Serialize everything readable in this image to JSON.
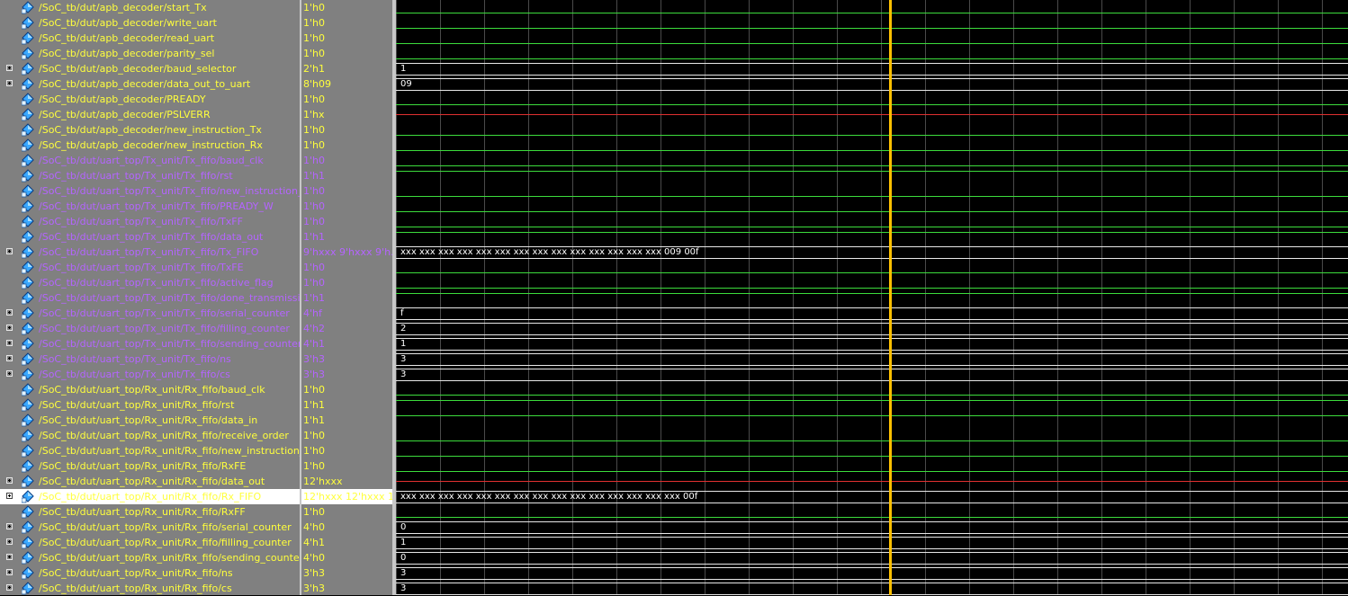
{
  "colors": {
    "tx_text": "#b464ff",
    "rx_text": "#ffff3c",
    "wave_zero": "#3cdc3c",
    "wave_x": "#e03030",
    "wave_bus": "#e8e8e8",
    "cursor": "#ffc000"
  },
  "icons": {
    "expand": "plus-box-icon",
    "signal": "diamond-signal-icon"
  },
  "signals": [
    {
      "name": "/SoC_tb/dut/apb_decoder/start_Tx",
      "value": "1'h0",
      "group": "apb",
      "bus": false,
      "wave": "0"
    },
    {
      "name": "/SoC_tb/dut/apb_decoder/write_uart",
      "value": "1'h0",
      "group": "apb",
      "bus": false,
      "wave": "0"
    },
    {
      "name": "/SoC_tb/dut/apb_decoder/read_uart",
      "value": "1'h0",
      "group": "apb",
      "bus": false,
      "wave": "0"
    },
    {
      "name": "/SoC_tb/dut/apb_decoder/parity_sel",
      "value": "1'h0",
      "group": "apb",
      "bus": false,
      "wave": "0"
    },
    {
      "name": "/SoC_tb/dut/apb_decoder/baud_selector",
      "value": "2'h1",
      "group": "apb",
      "bus": true,
      "wave": "bus",
      "label": "1"
    },
    {
      "name": "/SoC_tb/dut/apb_decoder/data_out_to_uart",
      "value": "8'h09",
      "group": "apb",
      "bus": true,
      "wave": "bus",
      "label": "09"
    },
    {
      "name": "/SoC_tb/dut/apb_decoder/PREADY",
      "value": "1'h0",
      "group": "apb",
      "bus": false,
      "wave": "0"
    },
    {
      "name": "/SoC_tb/dut/apb_decoder/PSLVERR",
      "value": "1'hx",
      "group": "apb",
      "bus": false,
      "wave": "x"
    },
    {
      "name": "/SoC_tb/dut/apb_decoder/new_instruction_Tx",
      "value": "1'h0",
      "group": "apb",
      "bus": false,
      "wave": "0"
    },
    {
      "name": "/SoC_tb/dut/apb_decoder/new_instruction_Rx",
      "value": "1'h0",
      "group": "apb",
      "bus": false,
      "wave": "0"
    },
    {
      "name": "/SoC_tb/dut/uart_top/Tx_unit/Tx_fifo/baud_clk",
      "value": "1'h0",
      "group": "tx",
      "bus": false,
      "wave": "0"
    },
    {
      "name": "/SoC_tb/dut/uart_top/Tx_unit/Tx_fifo/rst",
      "value": "1'h1",
      "group": "tx",
      "bus": false,
      "wave": "1"
    },
    {
      "name": "/SoC_tb/dut/uart_top/Tx_unit/Tx_fifo/new_instruction_Tx",
      "value": "1'h0",
      "group": "tx",
      "bus": false,
      "wave": "0"
    },
    {
      "name": "/SoC_tb/dut/uart_top/Tx_unit/Tx_fifo/PREADY_W",
      "value": "1'h0",
      "group": "tx",
      "bus": false,
      "wave": "0"
    },
    {
      "name": "/SoC_tb/dut/uart_top/Tx_unit/Tx_fifo/TxFF",
      "value": "1'h0",
      "group": "tx",
      "bus": false,
      "wave": "0"
    },
    {
      "name": "/SoC_tb/dut/uart_top/Tx_unit/Tx_fifo/data_out",
      "value": "1'h1",
      "group": "tx",
      "bus": false,
      "wave": "1"
    },
    {
      "name": "/SoC_tb/dut/uart_top/Tx_unit/Tx_fifo/Tx_FIFO",
      "value": "9'hxxx 9'hxxx 9'h...",
      "group": "tx",
      "bus": true,
      "wave": "bus",
      "label": "xxx xxx xxx xxx xxx xxx xxx xxx xxx xxx xxx xxx xxx xxx 009 00f"
    },
    {
      "name": "/SoC_tb/dut/uart_top/Tx_unit/Tx_fifo/TxFE",
      "value": "1'h0",
      "group": "tx",
      "bus": false,
      "wave": "0"
    },
    {
      "name": "/SoC_tb/dut/uart_top/Tx_unit/Tx_fifo/active_flag",
      "value": "1'h0",
      "group": "tx",
      "bus": false,
      "wave": "0"
    },
    {
      "name": "/SoC_tb/dut/uart_top/Tx_unit/Tx_fifo/done_transmission",
      "value": "1'h1",
      "group": "tx",
      "bus": false,
      "wave": "1"
    },
    {
      "name": "/SoC_tb/dut/uart_top/Tx_unit/Tx_fifo/serial_counter",
      "value": "4'hf",
      "group": "tx",
      "bus": true,
      "wave": "bus",
      "label": "f"
    },
    {
      "name": "/SoC_tb/dut/uart_top/Tx_unit/Tx_fifo/filling_counter",
      "value": "4'h2",
      "group": "tx",
      "bus": true,
      "wave": "bus",
      "label": "2"
    },
    {
      "name": "/SoC_tb/dut/uart_top/Tx_unit/Tx_fifo/sending_counter",
      "value": "4'h1",
      "group": "tx",
      "bus": true,
      "wave": "bus",
      "label": "1"
    },
    {
      "name": "/SoC_tb/dut/uart_top/Tx_unit/Tx_fifo/ns",
      "value": "3'h3",
      "group": "tx",
      "bus": true,
      "wave": "bus",
      "label": "3"
    },
    {
      "name": "/SoC_tb/dut/uart_top/Tx_unit/Tx_fifo/cs",
      "value": "3'h3",
      "group": "tx",
      "bus": true,
      "wave": "bus",
      "label": "3"
    },
    {
      "name": "/SoC_tb/dut/uart_top/Rx_unit/Rx_fifo/baud_clk",
      "value": "1'h0",
      "group": "rx",
      "bus": false,
      "wave": "0"
    },
    {
      "name": "/SoC_tb/dut/uart_top/Rx_unit/Rx_fifo/rst",
      "value": "1'h1",
      "group": "rx",
      "bus": false,
      "wave": "1"
    },
    {
      "name": "/SoC_tb/dut/uart_top/Rx_unit/Rx_fifo/data_in",
      "value": "1'h1",
      "group": "rx",
      "bus": false,
      "wave": "1"
    },
    {
      "name": "/SoC_tb/dut/uart_top/Rx_unit/Rx_fifo/receive_order",
      "value": "1'h0",
      "group": "rx",
      "bus": false,
      "wave": "0"
    },
    {
      "name": "/SoC_tb/dut/uart_top/Rx_unit/Rx_fifo/new_instruction_Rx",
      "value": "1'h0",
      "group": "rx",
      "bus": false,
      "wave": "0"
    },
    {
      "name": "/SoC_tb/dut/uart_top/Rx_unit/Rx_fifo/RxFE",
      "value": "1'h0",
      "group": "rx",
      "bus": false,
      "wave": "0"
    },
    {
      "name": "/SoC_tb/dut/uart_top/Rx_unit/Rx_fifo/data_out",
      "value": "12'hxxx",
      "group": "rx",
      "bus": true,
      "wave": "x"
    },
    {
      "name": "/SoC_tb/dut/uart_top/Rx_unit/Rx_fifo/Rx_FIFO",
      "value": "12'hxxx 12'hxxx 1...",
      "group": "rx",
      "bus": true,
      "wave": "bus",
      "label": "xxx xxx xxx xxx xxx xxx xxx xxx xxx xxx xxx xxx xxx xxx xxx 00f",
      "selected": true
    },
    {
      "name": "/SoC_tb/dut/uart_top/Rx_unit/Rx_fifo/RxFF",
      "value": "1'h0",
      "group": "rx",
      "bus": false,
      "wave": "0"
    },
    {
      "name": "/SoC_tb/dut/uart_top/Rx_unit/Rx_fifo/serial_counter",
      "value": "4'h0",
      "group": "rx",
      "bus": true,
      "wave": "bus",
      "label": "0"
    },
    {
      "name": "/SoC_tb/dut/uart_top/Rx_unit/Rx_fifo/filling_counter",
      "value": "4'h1",
      "group": "rx",
      "bus": true,
      "wave": "bus",
      "label": "1"
    },
    {
      "name": "/SoC_tb/dut/uart_top/Rx_unit/Rx_fifo/sending_counter",
      "value": "4'h0",
      "group": "rx",
      "bus": true,
      "wave": "bus",
      "label": "0"
    },
    {
      "name": "/SoC_tb/dut/uart_top/Rx_unit/Rx_fifo/ns",
      "value": "3'h3",
      "group": "rx",
      "bus": true,
      "wave": "bus",
      "label": "3"
    },
    {
      "name": "/SoC_tb/dut/uart_top/Rx_unit/Rx_fifo/cs",
      "value": "3'h3",
      "group": "rx",
      "bus": true,
      "wave": "bus",
      "label": "3"
    }
  ]
}
